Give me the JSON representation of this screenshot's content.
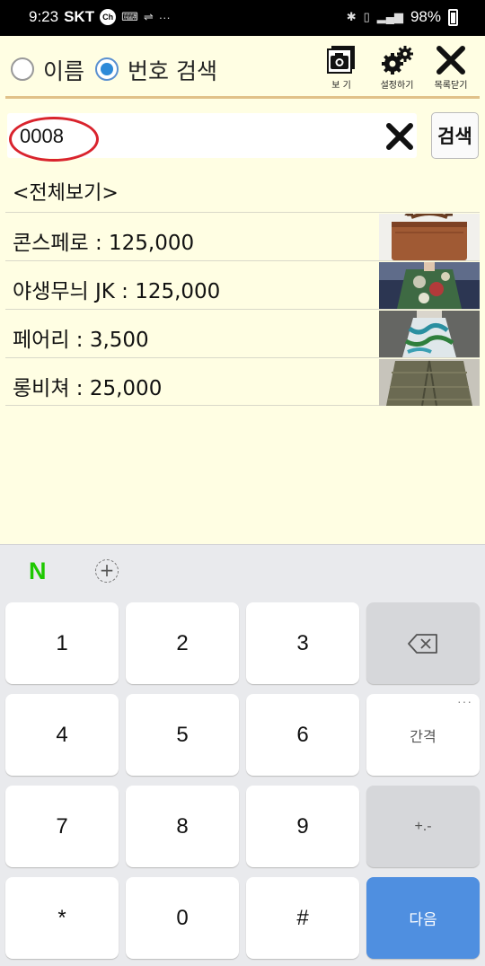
{
  "status_bar": {
    "time": "9:23",
    "carrier": "SKT",
    "ch_badge": "Ch",
    "extra": "···",
    "battery": "98%"
  },
  "header": {
    "radio_name_label": "이름",
    "radio_number_label": "번호 검색",
    "selected": "number",
    "view_label": "보 기",
    "settings_label": "설정하기",
    "close_label": "목록닫기"
  },
  "search": {
    "value": "0008",
    "placeholder": "",
    "button_label": "검색"
  },
  "view_all_label": "<전체보기>",
  "items": [
    {
      "label": "콘스페로 : 125,000",
      "thumb": "brown-bag"
    },
    {
      "label": "야생무늬 JK : 125,000",
      "thumb": "floral-jacket"
    },
    {
      "label": "페어리 : 3,500",
      "thumb": "print-skirt"
    },
    {
      "label": "롱비쳐 : 25,000",
      "thumb": "olive-coat"
    }
  ],
  "keyboard": {
    "brand": "N",
    "plus": "+",
    "keys": [
      "1",
      "2",
      "3",
      "4",
      "5",
      "6",
      "7",
      "8",
      "9",
      "*",
      "0",
      "#"
    ],
    "space_label": "간격",
    "sign_label": "+.-",
    "next_label": "다음",
    "more_dots": "···"
  },
  "colors": {
    "background": "#fffee3",
    "accent_line": "#e1c189",
    "highlight_circle": "#d9232d",
    "next_key": "#4f8fe0",
    "naver_green": "#1ec800"
  }
}
